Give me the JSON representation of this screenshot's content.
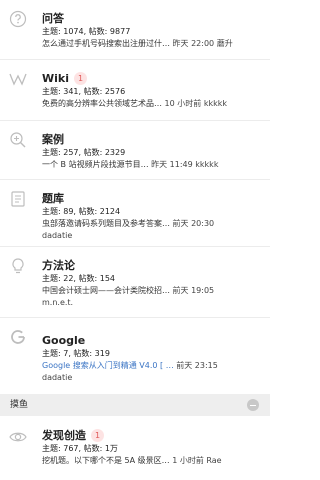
{
  "forums": [
    {
      "title": "问答",
      "stats": "主题: 1074, 帖数: 9877",
      "latest_title": "怎么通过手机号码搜索出注册过什…",
      "latest_time": "昨天 22:00",
      "latest_user": "蘑升",
      "icon": "question-circle-icon"
    },
    {
      "title": "Wiki",
      "badge": "1",
      "stats": "主题: 341, 帖数: 2576",
      "latest_title": "免费的高分辨率公共领域艺术品…",
      "latest_time": "10 小时前",
      "latest_user": "kkkkk",
      "icon": "wikipedia-w-icon"
    },
    {
      "title": "案例",
      "stats": "主题: 257, 帖数: 2329",
      "latest_title": "一个 B 站视频片段找源节目…",
      "latest_time": "昨天 11:49",
      "latest_user": "kkkkk",
      "icon": "magnifier-icon"
    },
    {
      "title": "题库",
      "stats": "主题: 89, 帖数: 2124",
      "latest_title": "虫部落邀请码系列题目及参考答案…",
      "latest_time": "前天 20:30",
      "user_line": "dadatie",
      "icon": "document-list-icon"
    },
    {
      "title": "方法论",
      "stats": "主题: 22, 帖数: 154",
      "latest_title": "中国会计硕士网——会计类院校招…",
      "latest_time": "前天 19:05",
      "user_line": "m.n.e.t.",
      "icon": "lightbulb-icon"
    },
    {
      "title": "Google",
      "stats": "主题: 7, 帖数: 319",
      "latest_title": "Google 搜索从入门到精通 V4.0 [ …",
      "latest_time": "前天 23:15",
      "user_line": "dadatie",
      "icon": "google-g-icon"
    }
  ],
  "section": {
    "label": "摸鱼"
  },
  "section_forums": [
    {
      "title": "发现创造",
      "badge": "1",
      "stats": "主题: 767, 帖数: 1万",
      "latest_title": "挖机题。以下哪个不是 5A 级景区…",
      "latest_time": "1 小时前",
      "latest_user": "Rae",
      "icon": "eye-icon"
    }
  ],
  "colors": {
    "badge_bg": "#fde3e3",
    "badge_text": "#e05a5a",
    "link_blue": "#3a74c4",
    "section_bg": "#eeeeee",
    "icon_gray": "#bdbdbd"
  }
}
